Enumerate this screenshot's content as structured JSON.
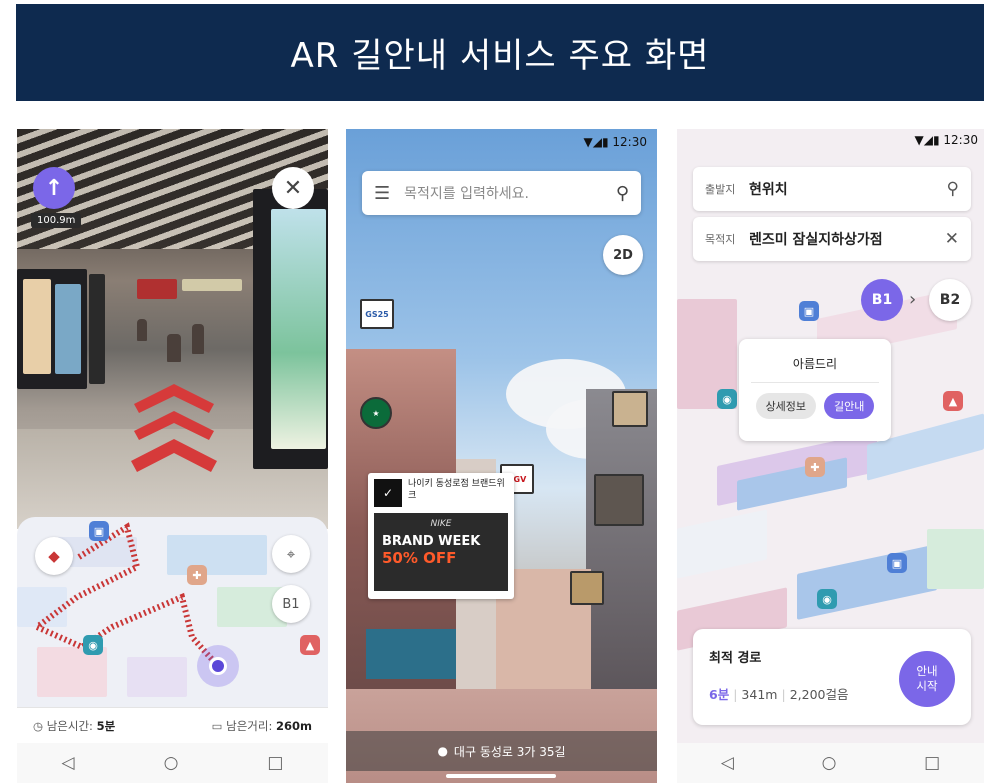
{
  "title": "AR 길안내 서비스 주요 화면",
  "phone1": {
    "distance": "100.9m",
    "arrow_icon": "↑",
    "close_icon": "✕",
    "compass_icon": "◆",
    "locate_icon": "⌖",
    "floor": "B1",
    "remaining_time_label": "남은시간: ",
    "remaining_time": "5분",
    "remaining_dist_label": "남은거리: ",
    "remaining_dist": "260m",
    "nav_back": "◁",
    "nav_home": "○",
    "nav_recent": "□"
  },
  "phone2": {
    "time": "12:30",
    "status_icons": "▼◢▮",
    "menu_icon": "☰",
    "search_placeholder": "목적지를 입력하세요.",
    "search_icon": "⚲",
    "view_toggle": "2D",
    "tag_gs25": "GS25",
    "tag_cgv": "CGV",
    "card_logo": "✓",
    "card_name": "나이키 동성로점 브랜드위크",
    "ad_brand": "NIKE",
    "ad_line1": "BRAND WEEK",
    "ad_line2": "50% OFF",
    "location_icon": "●",
    "address": "대구 동성로 3가 35길"
  },
  "phone3": {
    "time": "12:30",
    "status_icons": "▼◢▮",
    "origin_label": "출발지",
    "origin_value": "현위치",
    "search_icon": "⚲",
    "dest_label": "목적지",
    "dest_value": "렌즈미 잠실지하상가점",
    "clear_icon": "✕",
    "floor_from": "B1",
    "floor_arrow": "›",
    "floor_to": "B2",
    "popup_title": "아름드리",
    "detail_btn": "상세정보",
    "guide_btn": "길안내",
    "route_title": "최적 경로",
    "route_min": "6분",
    "route_dist": "341m",
    "route_steps": "2,200걸음",
    "start_btn": "안내\n시작",
    "nav_back": "◁",
    "nav_home": "○",
    "nav_recent": "□"
  }
}
